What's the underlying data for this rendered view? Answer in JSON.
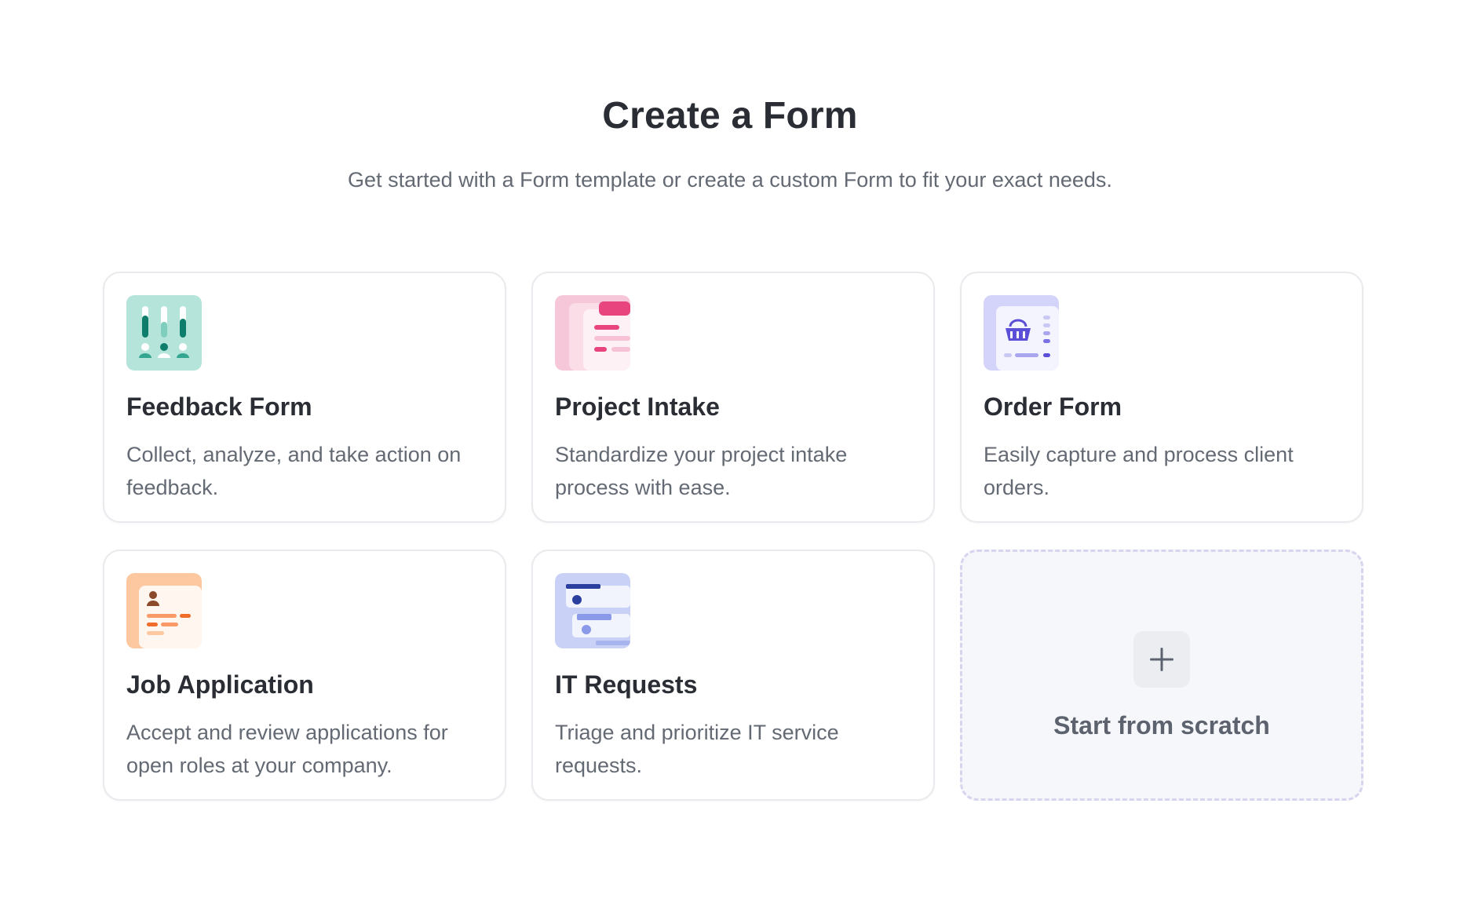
{
  "header": {
    "title": "Create a Form",
    "subtitle": "Get started with a Form template or create a custom Form to fit your exact needs."
  },
  "templates": [
    {
      "title": "Feedback Form",
      "description": "Collect, analyze, and take action on feedback.",
      "icon": "feedback-form-icon",
      "accent": "#b5e4da"
    },
    {
      "title": "Project Intake",
      "description": "Standardize your project intake process with ease.",
      "icon": "project-intake-icon",
      "accent": "#f6c7d9"
    },
    {
      "title": "Order Form",
      "description": "Easily capture and process client orders.",
      "icon": "order-form-icon",
      "accent": "#d4d3fa"
    },
    {
      "title": "Job Application",
      "description": "Accept and review applications for open roles at your company.",
      "icon": "job-application-icon",
      "accent": "#fdc7a0"
    },
    {
      "title": "IT Requests",
      "description": "Triage and prioritize IT service requests.",
      "icon": "it-requests-icon",
      "accent": "#c9d2f6"
    }
  ],
  "scratch": {
    "label": "Start from scratch",
    "icon": "plus-icon"
  }
}
